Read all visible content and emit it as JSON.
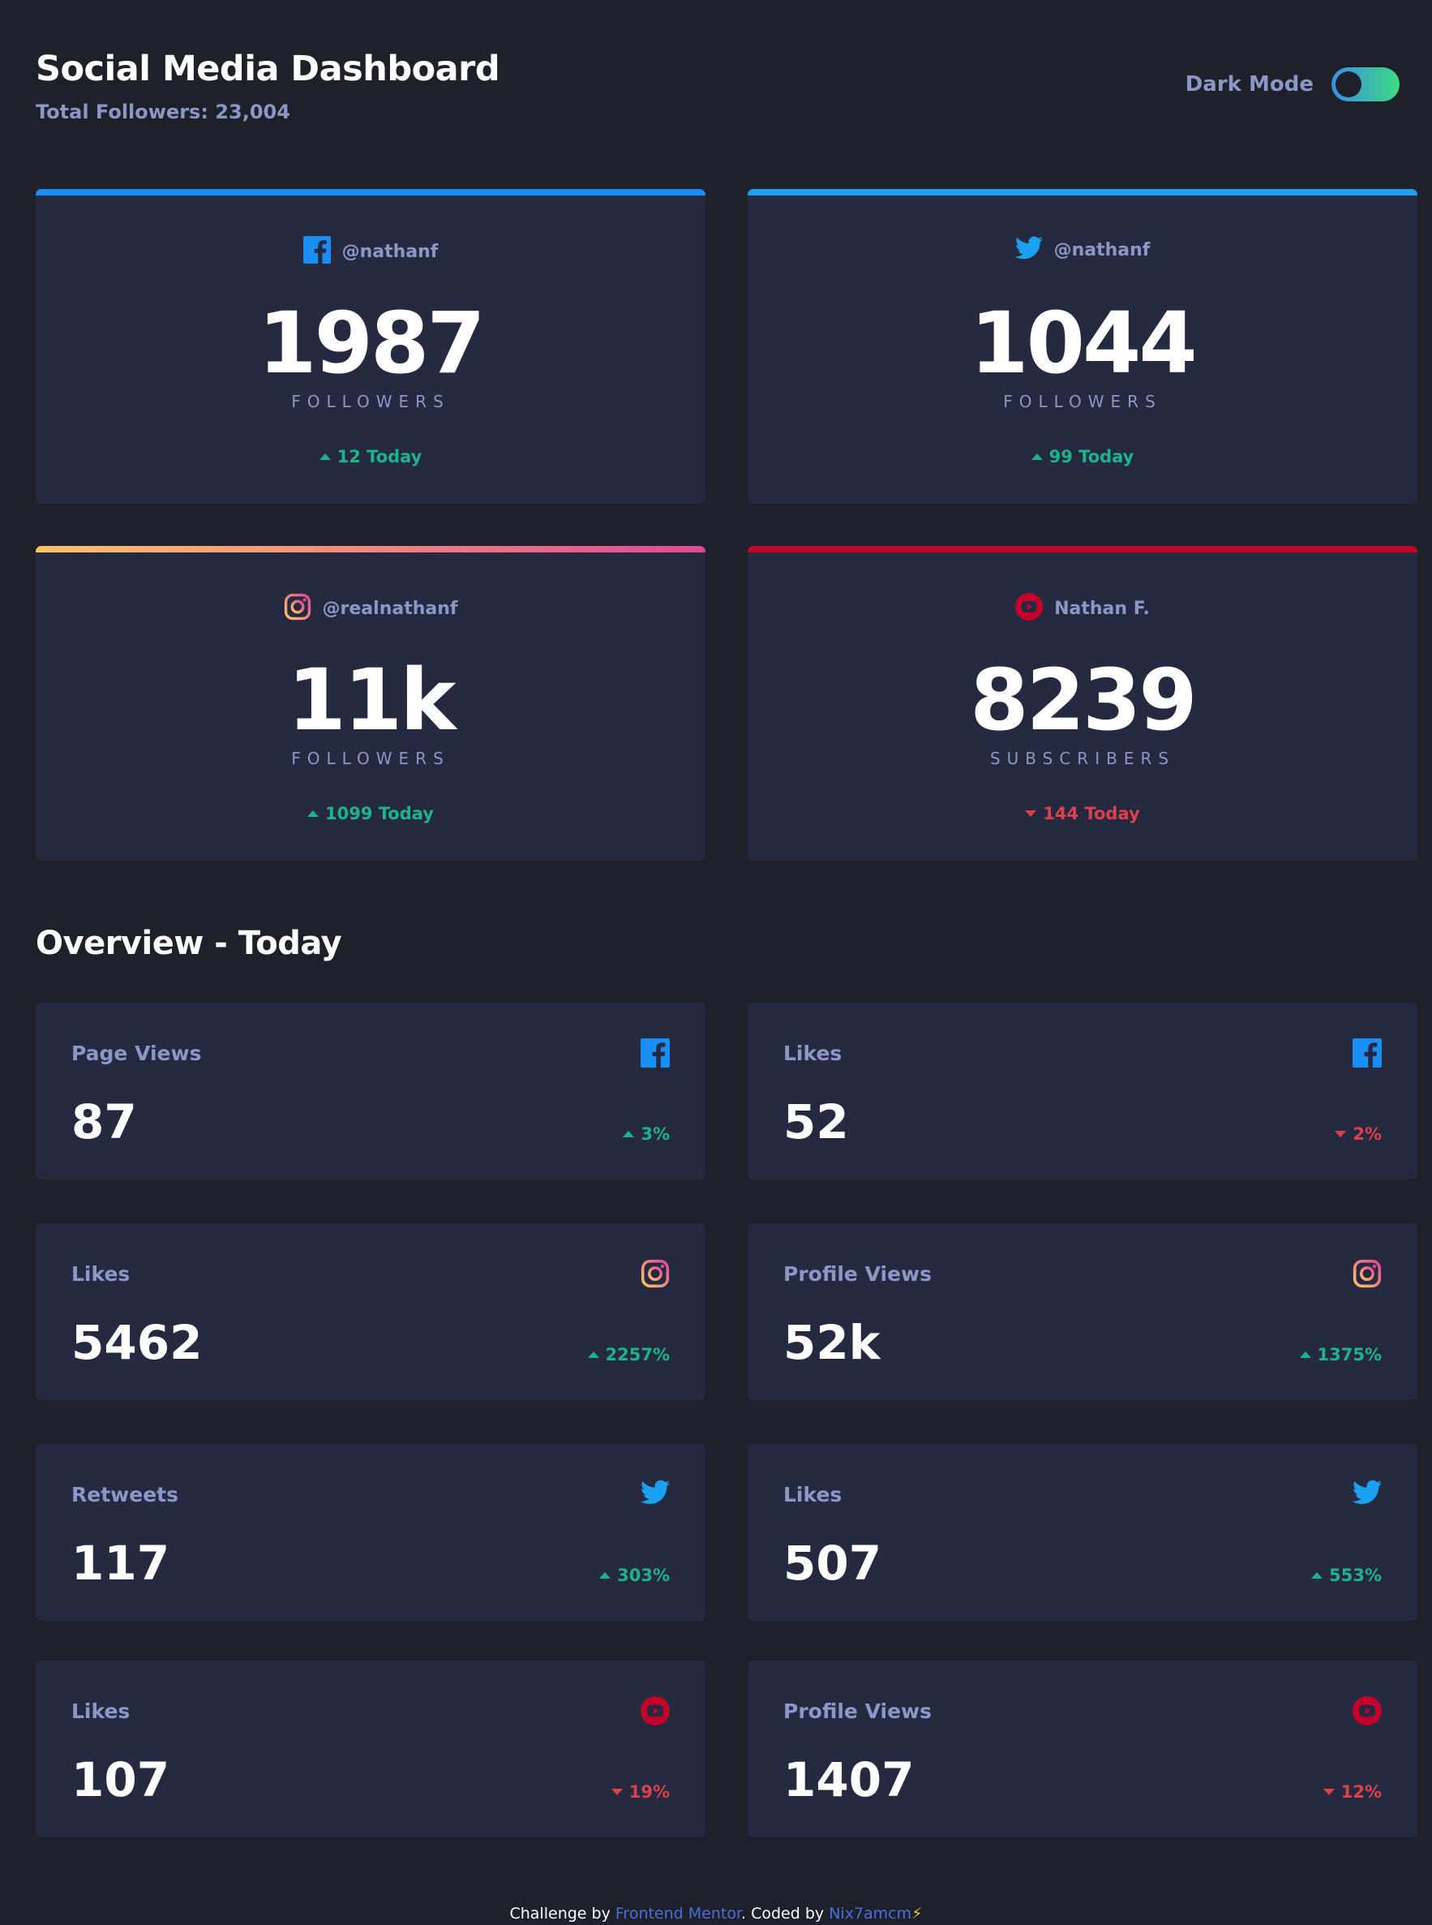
{
  "header": {
    "title": "Social Media Dashboard",
    "total_followers": "Total Followers: 23,004",
    "toggle_label": "Dark Mode"
  },
  "colors": {
    "background": "#1e202a",
    "card": "#252a41",
    "muted_text": "#8b97c6",
    "up": "#1db489",
    "down": "#dc414c",
    "facebook": "#198ff5",
    "twitter": "#1ca0f2",
    "instagram_start": "#fdc468",
    "instagram_end": "#df4996",
    "youtube": "#c4032a"
  },
  "cards": [
    {
      "platform": "facebook",
      "icon": "facebook-icon",
      "handle": "@nathanf",
      "count": "1987",
      "unit": "FOLLOWERS",
      "today": "12 Today",
      "trend": "up"
    },
    {
      "platform": "twitter",
      "icon": "twitter-icon",
      "handle": "@nathanf",
      "count": "1044",
      "unit": "FOLLOWERS",
      "today": "99 Today",
      "trend": "up"
    },
    {
      "platform": "instagram",
      "icon": "instagram-icon",
      "handle": "@realnathanf",
      "count": "11k",
      "unit": "FOLLOWERS",
      "today": "1099 Today",
      "trend": "up"
    },
    {
      "platform": "youtube",
      "icon": "youtube-icon",
      "handle": "Nathan F.",
      "count": "8239",
      "unit": "SUBSCRIBERS",
      "today": "144 Today",
      "trend": "down"
    }
  ],
  "overview": {
    "title": "Overview - Today",
    "items": [
      {
        "label": "Page Views",
        "platform": "facebook",
        "icon": "facebook-icon",
        "value": "87",
        "pct": "3%",
        "trend": "up"
      },
      {
        "label": "Likes",
        "platform": "facebook",
        "icon": "facebook-icon",
        "value": "52",
        "pct": "2%",
        "trend": "down"
      },
      {
        "label": "Likes",
        "platform": "instagram",
        "icon": "instagram-icon",
        "value": "5462",
        "pct": "2257%",
        "trend": "up"
      },
      {
        "label": "Profile Views",
        "platform": "instagram",
        "icon": "instagram-icon",
        "value": "52k",
        "pct": "1375%",
        "trend": "up"
      },
      {
        "label": "Retweets",
        "platform": "twitter",
        "icon": "twitter-icon",
        "value": "117",
        "pct": "303%",
        "trend": "up"
      },
      {
        "label": "Likes",
        "platform": "twitter",
        "icon": "twitter-icon",
        "value": "507",
        "pct": "553%",
        "trend": "up"
      },
      {
        "label": "Likes",
        "platform": "youtube",
        "icon": "youtube-icon",
        "value": "107",
        "pct": "19%",
        "trend": "down"
      },
      {
        "label": "Profile Views",
        "platform": "youtube",
        "icon": "youtube-icon",
        "value": "1407",
        "pct": "12%",
        "trend": "down"
      }
    ]
  },
  "footer": {
    "prefix": "Challenge by ",
    "link1": "Frontend Mentor",
    "middle": ". Coded by ",
    "link2": "Nix7amcm",
    "bolt": "⚡"
  }
}
